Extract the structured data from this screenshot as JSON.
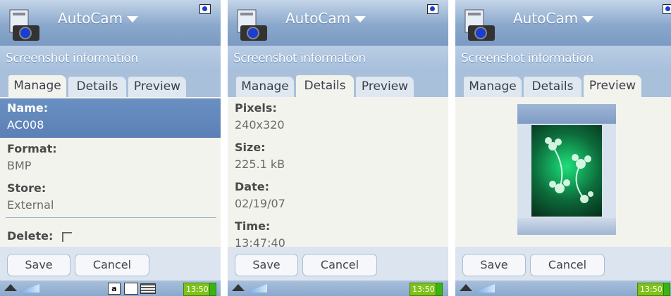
{
  "app": {
    "title": "AutoCam"
  },
  "subheader": "Screenshot information",
  "tabs": [
    "Manage",
    "Details",
    "Preview"
  ],
  "manage": {
    "name_label": "Name:",
    "name_value": "AC008",
    "format_label": "Format:",
    "format_value": "BMP",
    "store_label": "Store:",
    "store_value": "External",
    "delete_label": "Delete:"
  },
  "details": {
    "pixels_label": "Pixels:",
    "pixels_value": "240x320",
    "size_label": "Size:",
    "size_value": "225.1 kB",
    "date_label": "Date:",
    "date_value": "02/19/07",
    "time_label": "Time:",
    "time_value": "13:47:40"
  },
  "buttons": {
    "save": "Save",
    "cancel": "Cancel"
  },
  "status": {
    "clock": "13:50",
    "input_mode": "a"
  },
  "colors": {
    "accent": "#7b9ac2",
    "selection": "#6a90c2",
    "clock_bg": "#7ec318"
  }
}
